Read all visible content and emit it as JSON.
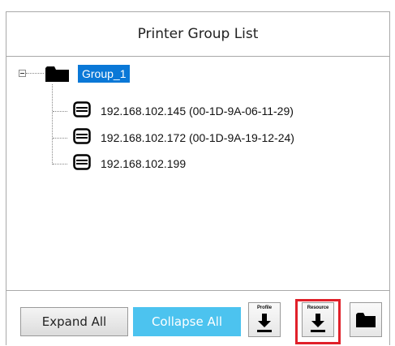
{
  "header": {
    "title": "Printer Group List"
  },
  "tree": {
    "group": {
      "label": "Group_1",
      "expanded": true,
      "selected": true
    },
    "printers": [
      {
        "label": "192.168.102.145 (00-1D-9A-06-11-29)"
      },
      {
        "label": "192.168.102.172 (00-1D-9A-19-12-24)"
      },
      {
        "label": "192.168.102.199"
      }
    ]
  },
  "footer": {
    "expand_all": "Expand All",
    "collapse_all": "Collapse All",
    "profile_label": "Profile",
    "resource_label": "Resource",
    "icons": {
      "profile": "download-icon",
      "resource": "download-icon",
      "folder": "folder-icon"
    }
  },
  "colors": {
    "selection": "#0a78d7",
    "collapse_button": "#4cc3ef",
    "highlight_border": "#e0202a"
  }
}
